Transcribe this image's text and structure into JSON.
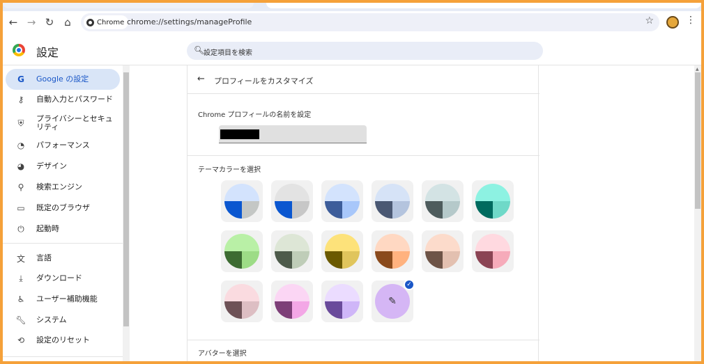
{
  "browser": {
    "site_chip_label": "Chrome",
    "url": "chrome://settings/manageProfile"
  },
  "settings": {
    "title": "設定",
    "search_placeholder": "設定項目を検索"
  },
  "sidebar": {
    "items": [
      {
        "label": "Google の設定",
        "icon": "google-g-icon"
      },
      {
        "label": "自動入力とパスワード",
        "icon": "key-icon"
      },
      {
        "label": "プライバシーとセキュリティ",
        "icon": "shield-icon"
      },
      {
        "label": "パフォーマンス",
        "icon": "speedometer-icon"
      },
      {
        "label": "デザイン",
        "icon": "palette-icon"
      },
      {
        "label": "検索エンジン",
        "icon": "search-icon"
      },
      {
        "label": "既定のブラウザ",
        "icon": "browser-window-icon"
      },
      {
        "label": "起動時",
        "icon": "power-icon"
      },
      {
        "label": "言語",
        "icon": "translate-icon"
      },
      {
        "label": "ダウンロード",
        "icon": "download-icon"
      },
      {
        "label": "ユーザー補助機能",
        "icon": "accessibility-icon"
      },
      {
        "label": "システム",
        "icon": "wrench-icon"
      },
      {
        "label": "設定のリセット",
        "icon": "reset-icon"
      }
    ]
  },
  "profile": {
    "header_title": "プロフィールをカスタマイズ",
    "name_label": "Chrome プロフィールの名前を設定",
    "theme_label": "テーマカラーを選択",
    "avatar_label": "アバターを選択"
  },
  "theme_colors": [
    {
      "top": "#d3e3fd",
      "bl": "#0b57d0",
      "br": "#c4c7c5"
    },
    {
      "top": "#e3e3e3",
      "bl": "#0b57d0",
      "br": "#c7c7c7"
    },
    {
      "top": "#d3e3fd",
      "bl": "#3d5d9a",
      "br": "#a8c7fa"
    },
    {
      "top": "#d6e3f7",
      "bl": "#4a5873",
      "br": "#b4c4de"
    },
    {
      "top": "#d3e3e4",
      "bl": "#4e5c5d",
      "br": "#b5c9ca"
    },
    {
      "top": "#8df2e2",
      "bl": "#006b5f",
      "br": "#6fd9c8"
    },
    {
      "top": "#b9f0a6",
      "bl": "#3d6b32",
      "br": "#9ddc86"
    },
    {
      "top": "#dde6d6",
      "bl": "#4e5b4b",
      "br": "#bfcdb8"
    },
    {
      "top": "#fde27a",
      "bl": "#6b5a00",
      "br": "#e0c55c"
    },
    {
      "top": "#ffd8c2",
      "bl": "#8a4a1c",
      "br": "#ffb27f"
    },
    {
      "top": "#fcdbcb",
      "bl": "#6e5447",
      "br": "#e3c0b0"
    },
    {
      "top": "#ffd9e0",
      "bl": "#8b4454",
      "br": "#f6abba"
    },
    {
      "top": "#fadbe0",
      "bl": "#6e5257",
      "br": "#ddbec3"
    },
    {
      "top": "#fbd6f4",
      "bl": "#7d3f78",
      "br": "#f3a7e6"
    },
    {
      "top": "#ebdcff",
      "bl": "#6a4b9b",
      "br": "#cfb6f8"
    }
  ],
  "custom_color": {
    "icon": "pen-icon",
    "selected": true,
    "color": "#d5b6f5"
  }
}
